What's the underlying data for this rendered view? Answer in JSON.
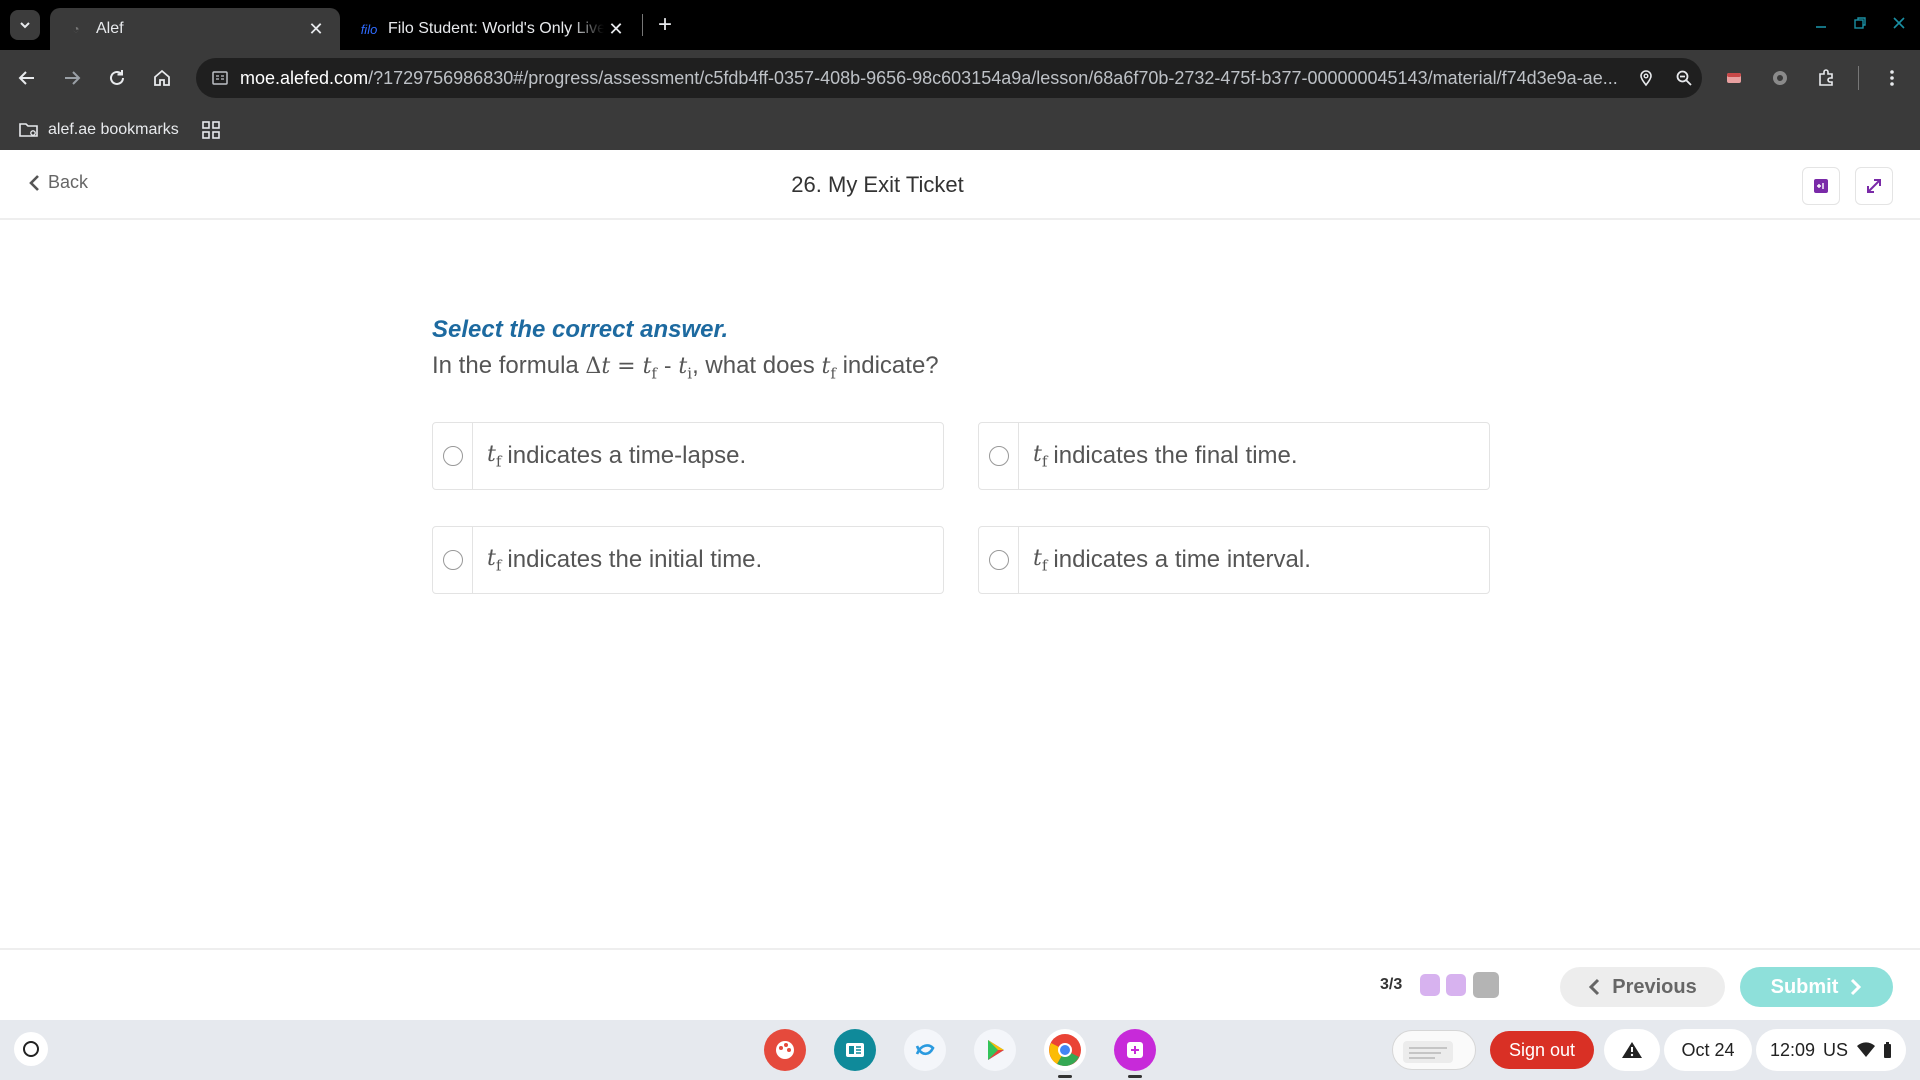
{
  "browser": {
    "tabs": [
      {
        "title": "Alef",
        "active": true
      },
      {
        "title": "Filo Student: World's Only Live I",
        "favicon_text": "filo",
        "active": false
      }
    ],
    "url_host": "moe.alefed.com",
    "url_path": "/?1729756986830#/progress/assessment/c5fdb4ff-0357-408b-9656-98c603154a9a/lesson/68a6f70b-2732-475f-b377-000000045143/material/f74d3e9a-ae...",
    "bookmark_folder": "alef.ae bookmarks"
  },
  "header": {
    "back_label": "Back",
    "title": "26. My Exit Ticket"
  },
  "question": {
    "instruction": "Select the correct answer.",
    "prefix": "In the formula",
    "formula_delta": "Δ",
    "formula_t": "t",
    "formula_eq": " = ",
    "formula_tf": "t",
    "formula_f": "f",
    "formula_minus": " - ",
    "formula_ti": "t",
    "formula_i": "i",
    "middle": ", what does",
    "target_t": "t",
    "target_f": "f",
    "suffix": "indicate?"
  },
  "options": [
    {
      "var": "t",
      "sub": "f",
      "text": "indicates a time-lapse."
    },
    {
      "var": "t",
      "sub": "f",
      "text": "indicates the final time."
    },
    {
      "var": "t",
      "sub": "f",
      "text": "indicates the initial time."
    },
    {
      "var": "t",
      "sub": "f",
      "text": "indicates a time interval."
    }
  ],
  "footer": {
    "progress": "3/3",
    "previous_label": "Previous",
    "submit_label": "Submit",
    "dot_colors": [
      "#d7b2ef",
      "#d7b2ef",
      "#b4b4b4"
    ]
  },
  "shelf": {
    "signout_label": "Sign out",
    "date": "Oct 24",
    "time": "12:09",
    "locale": "US"
  },
  "colors": {
    "accent_blue": "#1d6aa0",
    "submit_teal": "#8ee0da",
    "signout_red": "#d93025"
  }
}
